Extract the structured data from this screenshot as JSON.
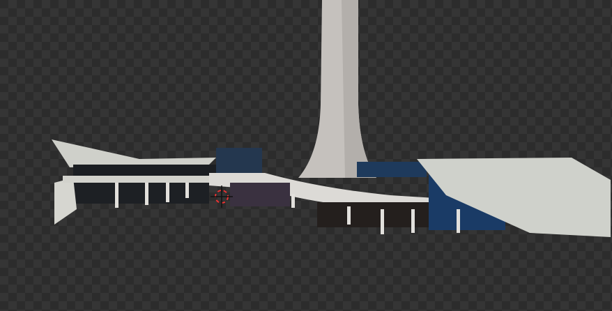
{
  "viewport": {
    "mode": "render-preview",
    "colors": {
      "checker_dark": "#2c2c2c",
      "checker_light": "#353535",
      "tower": "#c9c4c0",
      "roof": "#cfd0ca",
      "glass": "#1f3a5a",
      "cursor_ring": "#d33"
    }
  },
  "cursor": {
    "icon": "3d-cursor-icon"
  }
}
